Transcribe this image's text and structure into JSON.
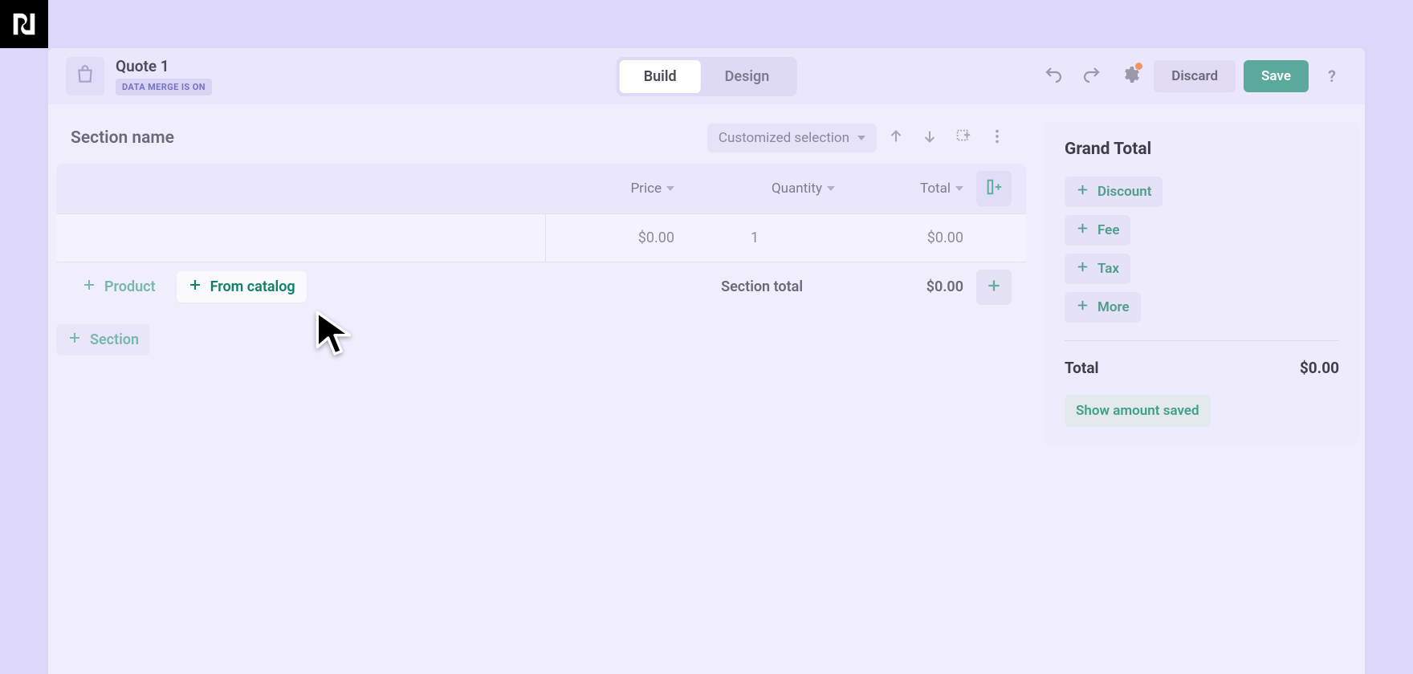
{
  "header": {
    "title": "Quote 1",
    "merge_badge": "DATA MERGE IS ON",
    "tabs": {
      "build": "Build",
      "design": "Design"
    },
    "discard": "Discard",
    "save": "Save",
    "help": "?"
  },
  "section": {
    "title": "Section name",
    "selector": "Customized selection",
    "columns": {
      "price": "Price",
      "quantity": "Quantity",
      "total": "Total"
    },
    "row": {
      "price": "$0.00",
      "quantity": "1",
      "total": "$0.00"
    },
    "footer": {
      "product": "Product",
      "from_catalog": "From catalog",
      "section_total_label": "Section total",
      "section_total_value": "$0.00"
    },
    "add_section": "Section"
  },
  "grand_total": {
    "title": "Grand Total",
    "chips": {
      "discount": "Discount",
      "fee": "Fee",
      "tax": "Tax",
      "more": "More"
    },
    "total_label": "Total",
    "total_value": "$0.00",
    "show_saved": "Show amount saved"
  }
}
